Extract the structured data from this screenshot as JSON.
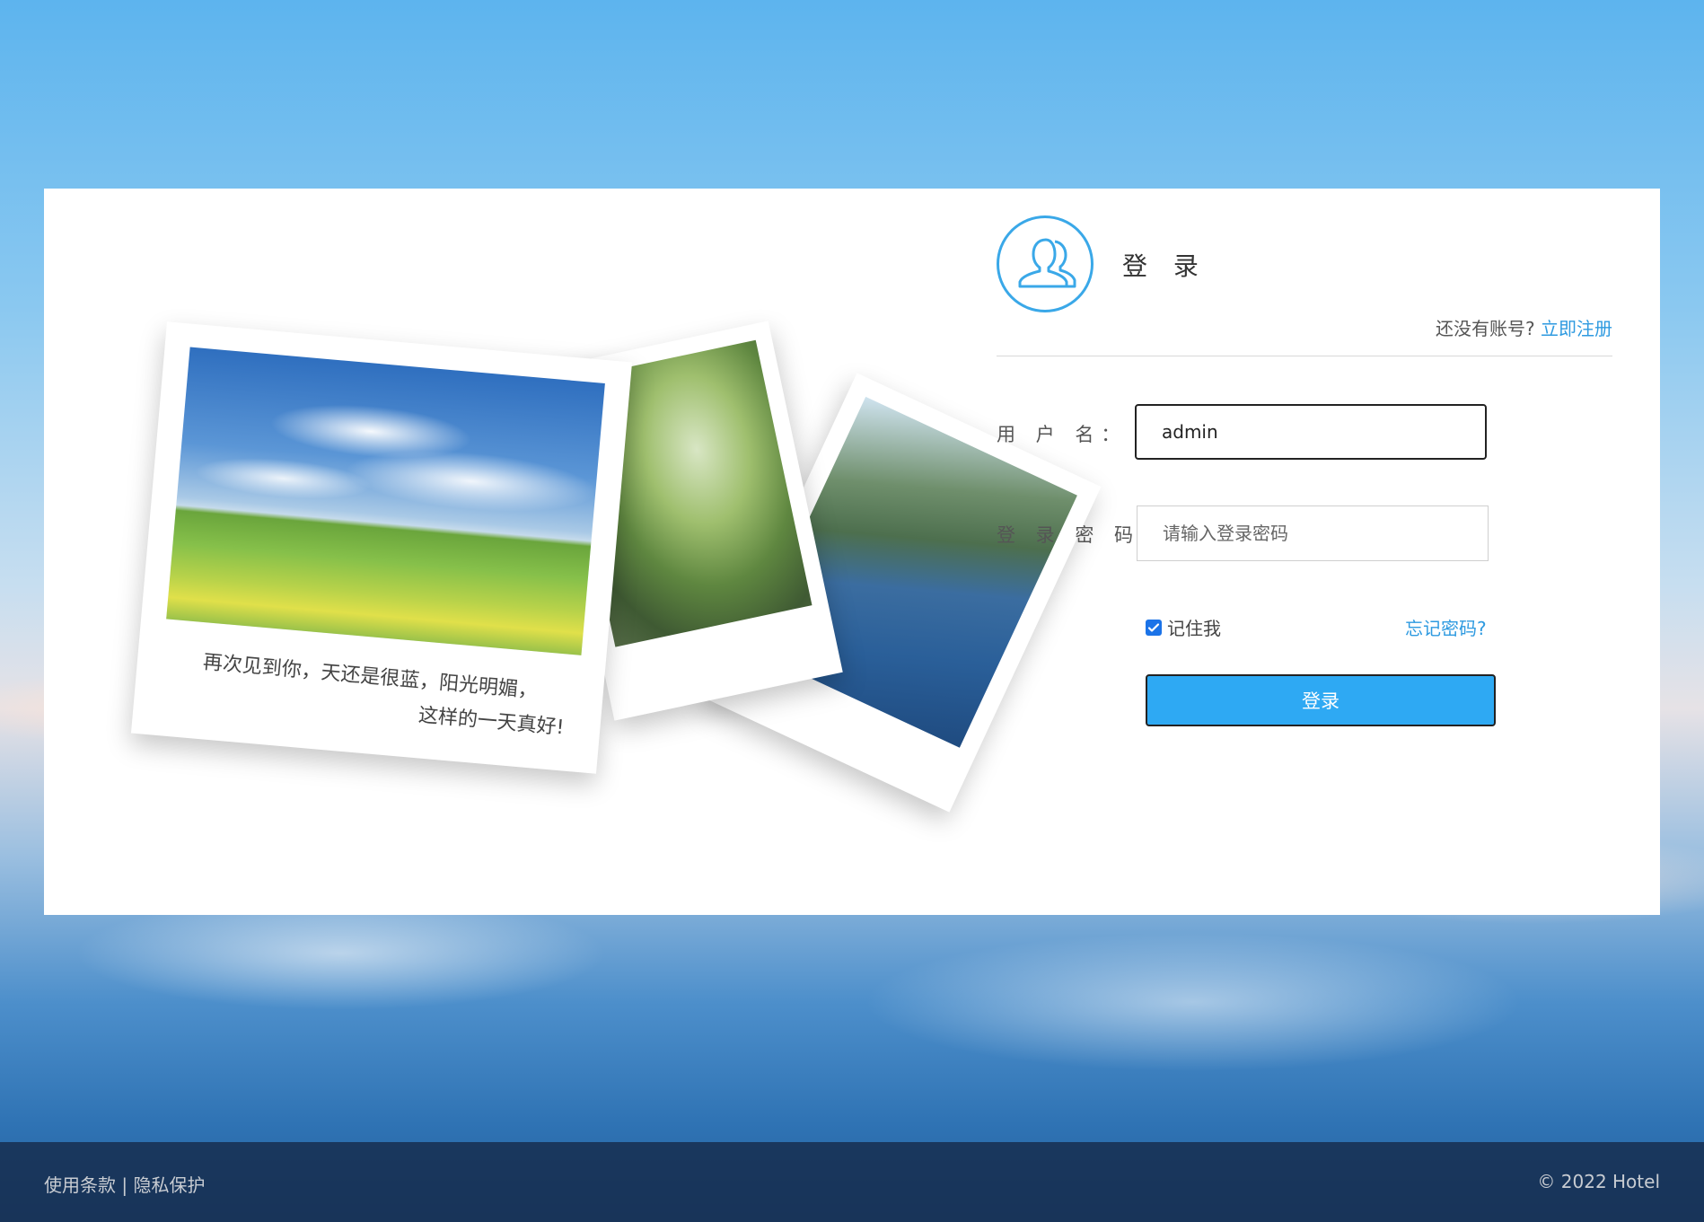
{
  "login": {
    "title": "登 录",
    "no_account_text": "还没有账号?",
    "register_link": "立即注册",
    "username_label": "用 户 名：",
    "username_value": "admin",
    "password_label": "登 录 密 码：",
    "password_placeholder": "请输入登录密码",
    "remember_label": "记住我",
    "remember_checked": true,
    "forgot_link": "忘记密码?",
    "submit_label": "登录"
  },
  "photo": {
    "caption_line1": "再次见到你，天还是很蓝，阳光明媚，",
    "caption_line2": "这样的一天真好!"
  },
  "footer": {
    "terms_link": "使用条款",
    "separator": "|",
    "privacy_link": "隐私保护",
    "copyright": "© 2022 Hotel"
  },
  "colors": {
    "accent": "#2ea9f3",
    "link": "#2e9ae0"
  },
  "icons": {
    "avatar": "users-icon",
    "checkbox": "checkmark-icon"
  }
}
